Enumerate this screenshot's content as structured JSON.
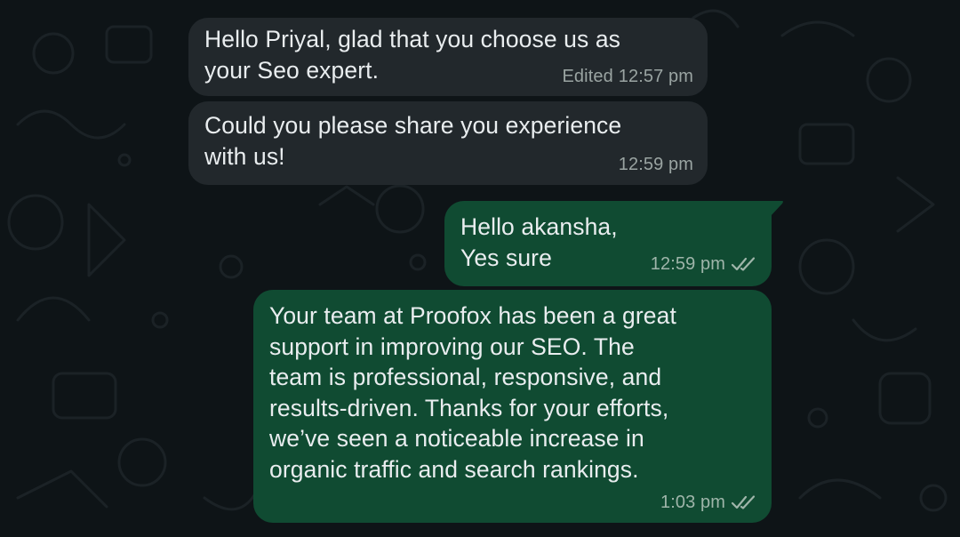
{
  "messages": [
    {
      "direction": "incoming",
      "text": "Hello Priyal, glad that you choose us as\nyour Seo expert.",
      "edited_label": "Edited",
      "time": "12:57 pm"
    },
    {
      "direction": "incoming",
      "text": "Could you please share you experience\nwith us!",
      "time": "12:59 pm"
    },
    {
      "direction": "outgoing",
      "text": "Hello akansha,\nYes sure",
      "time": "12:59 pm",
      "status": "read-double-check-icon"
    },
    {
      "direction": "outgoing",
      "text": "Your team at Proofox has been a great\nsupport in improving our SEO. The\nteam is professional, responsive, and\nresults-driven. Thanks for your efforts,\nwe’ve seen a noticeable increase in\norganic traffic and search rankings.",
      "time": "1:03 pm",
      "status": "read-double-check-icon"
    }
  ],
  "colors": {
    "background": "#0e1417",
    "incoming_bubble": "#22282c",
    "outgoing_bubble": "#104b32",
    "text": "#e9edef",
    "meta_text": "#9aa4a2"
  }
}
